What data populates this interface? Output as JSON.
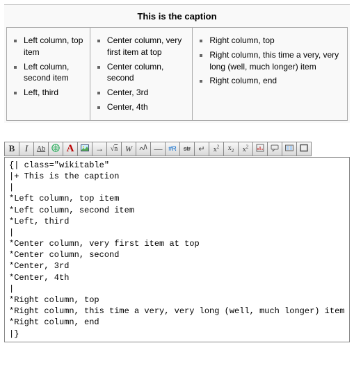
{
  "rendered": {
    "caption": "This is the caption",
    "columns": [
      {
        "items": [
          "Left column, top item",
          "Left column, second item",
          "Left, third"
        ]
      },
      {
        "items": [
          "Center column, very first item at top",
          "Center column, second",
          "Center, 3rd",
          "Center, 4th"
        ]
      },
      {
        "items": [
          "Right column, top",
          "Right column, this time a very, very long (well, much longer) item",
          "Right column, end"
        ]
      }
    ]
  },
  "toolbar": [
    {
      "name": "bold-button",
      "label": "B",
      "icon": "bold"
    },
    {
      "name": "italic-button",
      "label": "I",
      "icon": "italic"
    },
    {
      "name": "strike-button",
      "label": "Ab",
      "icon": "ab-strike"
    },
    {
      "name": "globe-link-button",
      "label": "",
      "icon": "globe"
    },
    {
      "name": "font-color-button",
      "label": "A",
      "icon": "big-a"
    },
    {
      "name": "image-button",
      "label": "",
      "icon": "image"
    },
    {
      "name": "arrow-button",
      "label": "→",
      "icon": "arrow"
    },
    {
      "name": "sqrt-button",
      "label": "√n",
      "icon": "sqrt"
    },
    {
      "name": "wiki-w-button",
      "label": "W",
      "icon": "w"
    },
    {
      "name": "signature-button",
      "label": "",
      "icon": "sig"
    },
    {
      "name": "hr-button",
      "label": "—",
      "icon": "hr"
    },
    {
      "name": "redirect-hash-button",
      "label": "#R",
      "icon": "hashr"
    },
    {
      "name": "strikethrough-button",
      "label": "str",
      "icon": "str-strike"
    },
    {
      "name": "linebreak-button",
      "label": "↵",
      "icon": "lbr"
    },
    {
      "name": "super-x2-button",
      "label": "x²",
      "icon": "sup"
    },
    {
      "name": "sub-x2-button",
      "label": "x₂",
      "icon": "sub"
    },
    {
      "name": "small-x2-button",
      "label": "x²",
      "icon": "sup"
    },
    {
      "name": "insert-chart-button",
      "label": "",
      "icon": "chart"
    },
    {
      "name": "comment-button",
      "label": "",
      "icon": "comment"
    },
    {
      "name": "gallery-button",
      "label": "",
      "icon": "gallery"
    },
    {
      "name": "frame-button",
      "label": "",
      "icon": "frame"
    }
  ],
  "source": {
    "lines": [
      "{| class=\"wikitable\"",
      "|+ This is the caption",
      "|",
      "*Left column, top item",
      "*Left column, second item",
      "*Left, third",
      "|",
      "*Center column, very first item at top",
      "*Center column, second",
      "*Center, 3rd",
      "*Center, 4th",
      "|",
      "*Right column, top",
      "*Right column, this time a very, very long (well, much longer) item",
      "*Right column, end",
      "|}"
    ]
  }
}
